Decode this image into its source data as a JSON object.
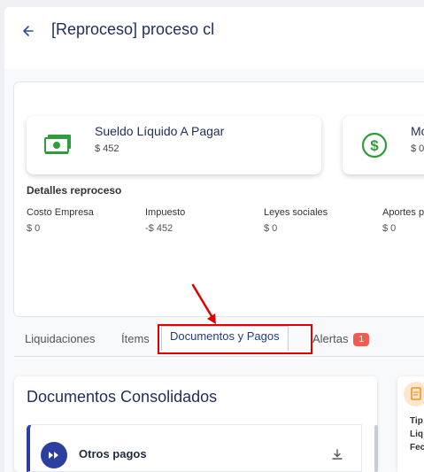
{
  "header": {
    "title": "[Reproceso] proceso cl"
  },
  "kpis": [
    {
      "label": "Sueldo Líquido A Pagar",
      "value": "$ 452",
      "icon": "money-icon",
      "color": "#2e9e3a"
    },
    {
      "label": "Mo",
      "value": "$ 0",
      "icon": "dollar-circle-icon",
      "color": "#2e9e3a"
    }
  ],
  "details": {
    "title": "Detalles reproceso",
    "items": [
      {
        "label": "Costo Empresa",
        "value": "$ 0"
      },
      {
        "label": "Impuesto",
        "value": "-$ 452"
      },
      {
        "label": "Leyes sociales",
        "value": "$ 0"
      },
      {
        "label": "Aportes p",
        "value": "$ 0"
      }
    ]
  },
  "tabs": [
    {
      "label": "Liquidaciones"
    },
    {
      "label": "Ítems"
    },
    {
      "label": "Documentos y Pagos",
      "active": true
    },
    {
      "label": "Alertas",
      "badge": "1"
    }
  ],
  "documents": {
    "title": "Documentos Consolidados",
    "items": [
      {
        "label": "Otros pagos",
        "icon": "fast-forward-icon"
      }
    ]
  },
  "side_panel": {
    "lines": [
      "Tip",
      "Liq",
      "Fec"
    ]
  },
  "colors": {
    "accent": "#1f3a8a",
    "badge": "#f25c4f",
    "highlight": "#e00000",
    "money": "#2e9e3a"
  }
}
